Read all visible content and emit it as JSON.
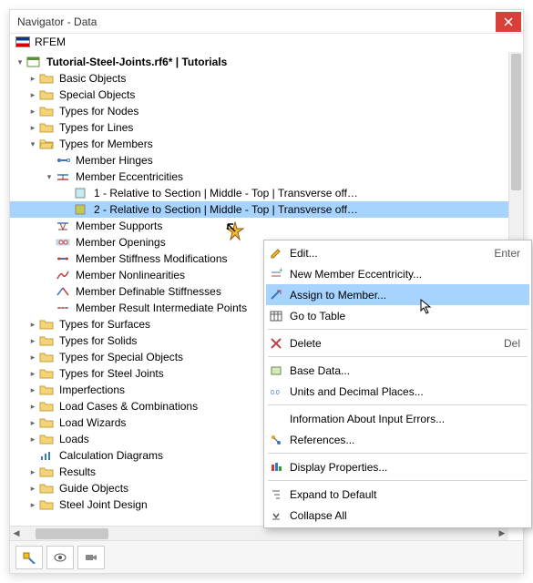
{
  "window": {
    "title": "Navigator - Data"
  },
  "app": {
    "name": "RFEM"
  },
  "root": {
    "label": "Tutorial-Steel-Joints.rf6* | Tutorials"
  },
  "tree": {
    "basic_objects": "Basic Objects",
    "special_objects": "Special Objects",
    "types_for_nodes": "Types for Nodes",
    "types_for_lines": "Types for Lines",
    "types_for_members": "Types for Members",
    "member_hinges": "Member Hinges",
    "member_ecc": "Member Eccentricities",
    "ecc1": "1 - Relative to Section | Middle - Top | Transverse off…",
    "ecc2": "2 - Relative to Section | Middle - Top | Transverse off…",
    "member_supports": "Member Supports",
    "member_openings": "Member Openings",
    "member_stiffness_mod": "Member Stiffness Modifications",
    "member_nonlin": "Member Nonlinearities",
    "member_def_stiff": "Member Definable Stiffnesses",
    "member_result_int": "Member Result Intermediate Points",
    "types_for_surfaces": "Types for Surfaces",
    "types_for_solids": "Types for Solids",
    "types_for_special": "Types for Special Objects",
    "types_for_steel_joints": "Types for Steel Joints",
    "imperfections": "Imperfections",
    "load_cases": "Load Cases & Combinations",
    "load_wizards": "Load Wizards",
    "loads": "Loads",
    "calc_diagrams": "Calculation Diagrams",
    "results": "Results",
    "guide_objects": "Guide Objects",
    "steel_joint_design": "Steel Joint Design"
  },
  "menu": {
    "edit": "Edit...",
    "edit_shortcut": "Enter",
    "new_ecc": "New Member Eccentricity...",
    "assign": "Assign to Member...",
    "go_to_table": "Go to Table",
    "delete": "Delete",
    "delete_shortcut": "Del",
    "base_data": "Base Data...",
    "units": "Units and Decimal Places...",
    "info_errors": "Information About Input Errors...",
    "references": "References...",
    "display_props": "Display Properties...",
    "expand_default": "Expand to Default",
    "collapse_all": "Collapse All"
  }
}
